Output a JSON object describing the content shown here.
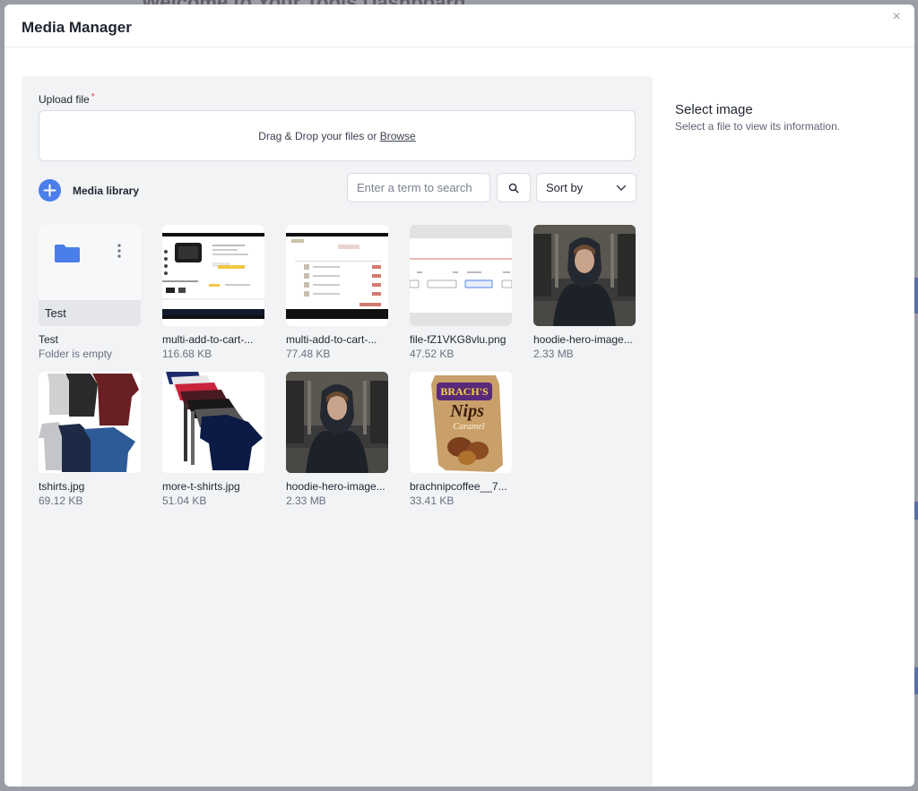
{
  "backdrop": {
    "title": "Welcome to Your Tools Dashboard"
  },
  "modal": {
    "title": "Media Manager",
    "close_label": "×"
  },
  "upload": {
    "label": "Upload file",
    "required_mark": "*",
    "drop_text": "Drag & Drop your files or ",
    "browse_label": "Browse"
  },
  "toolbar": {
    "add_icon": "plus-icon",
    "library_label": "Media library",
    "search_placeholder": "Enter a term to search",
    "search_icon": "search-icon",
    "sort_label": "Sort by",
    "sort_icon": "chevron-down-icon"
  },
  "items": [
    {
      "type": "folder",
      "name": "Test",
      "meta": "Folder is empty",
      "thumb_label": "Test"
    },
    {
      "type": "image",
      "name": "multi-add-to-cart-...",
      "meta": "116.68 KB"
    },
    {
      "type": "image",
      "name": "multi-add-to-cart-...",
      "meta": "77.48 KB"
    },
    {
      "type": "image",
      "name": "file-fZ1VKG8vlu.png",
      "meta": "47.52 KB"
    },
    {
      "type": "image",
      "name": "hoodie-hero-image...",
      "meta": "2.33 MB"
    },
    {
      "type": "image",
      "name": "tshirts.jpg",
      "meta": "69.12 KB"
    },
    {
      "type": "image",
      "name": "more-t-shirts.jpg",
      "meta": "51.04 KB"
    },
    {
      "type": "image",
      "name": "hoodie-hero-image...",
      "meta": "2.33 MB"
    },
    {
      "type": "image",
      "name": "brachnipcoffee__7...",
      "meta": "33.41 KB",
      "thumb_text": {
        "brand": "BRACH'S",
        "product": "Nips",
        "flavor": "Caramel"
      }
    }
  ],
  "details": {
    "title": "Select image",
    "subtitle": "Select a file to view its information."
  },
  "colors": {
    "accent": "#4a7ee8",
    "required": "#d9363e",
    "panel_bg": "#f2f3f5"
  }
}
